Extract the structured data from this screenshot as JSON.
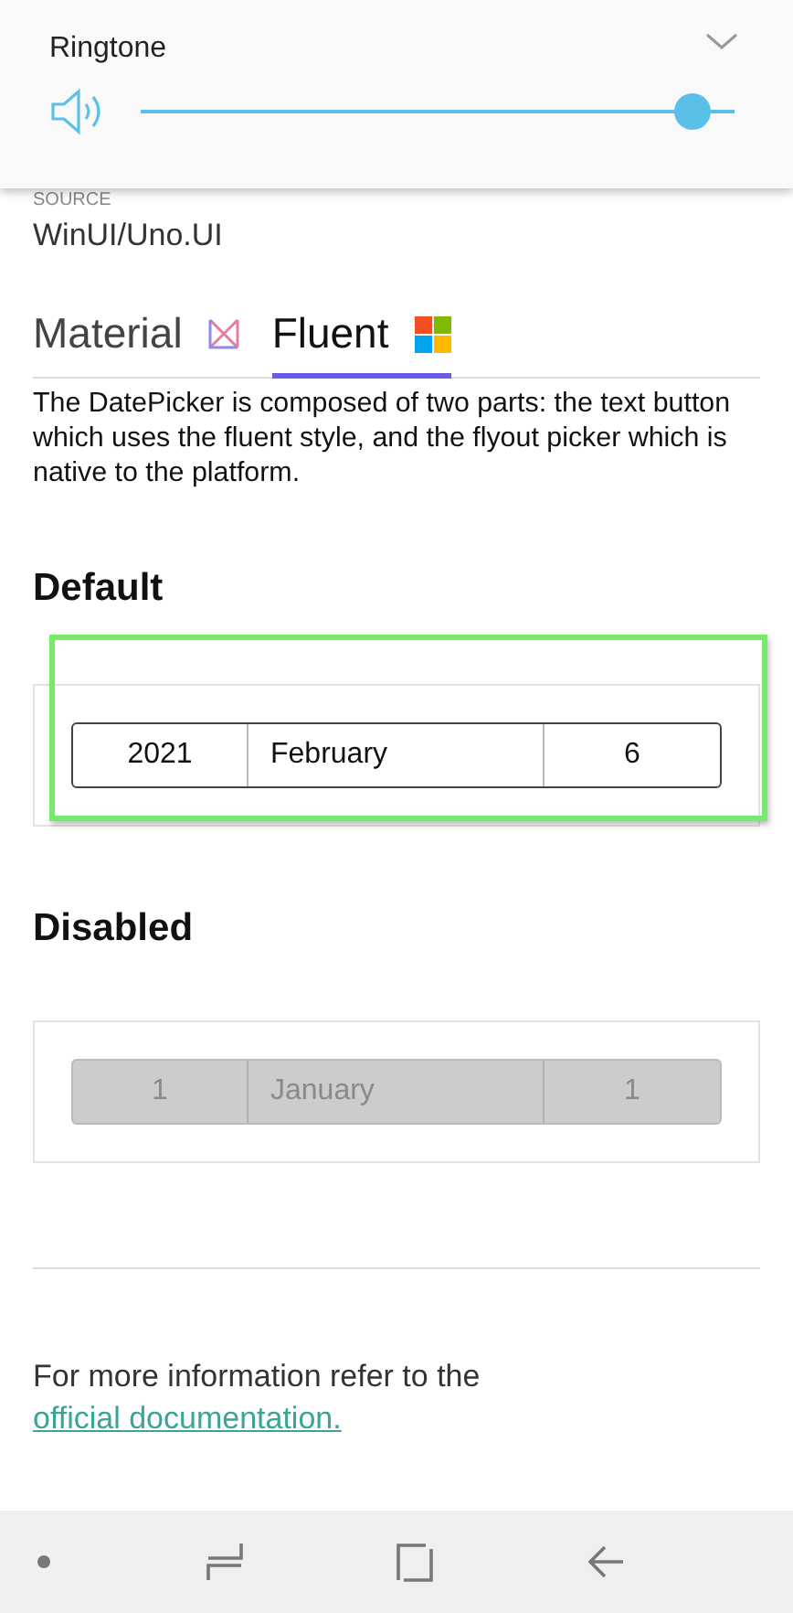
{
  "volume_panel": {
    "title": "Ringtone",
    "level": 0.93
  },
  "source": {
    "label": "SOURCE",
    "value": "WinUI/Uno.UI"
  },
  "tabs": [
    {
      "label": "Material",
      "selected": false,
      "kind": "material"
    },
    {
      "label": "Fluent",
      "selected": true,
      "kind": "fluent"
    }
  ],
  "description": "The DatePicker is composed of two parts: the text button which uses the fluent style, and the flyout picker which is native to the platform.",
  "sections": [
    {
      "title": "Default",
      "disabled": false,
      "focused": true,
      "year": "2021",
      "month": "February",
      "day": "6"
    },
    {
      "title": "Disabled",
      "disabled": true,
      "focused": false,
      "year": "1",
      "month": "January",
      "day": "1"
    }
  ],
  "footer": {
    "text": "For more information refer to the",
    "link": "official documentation."
  }
}
